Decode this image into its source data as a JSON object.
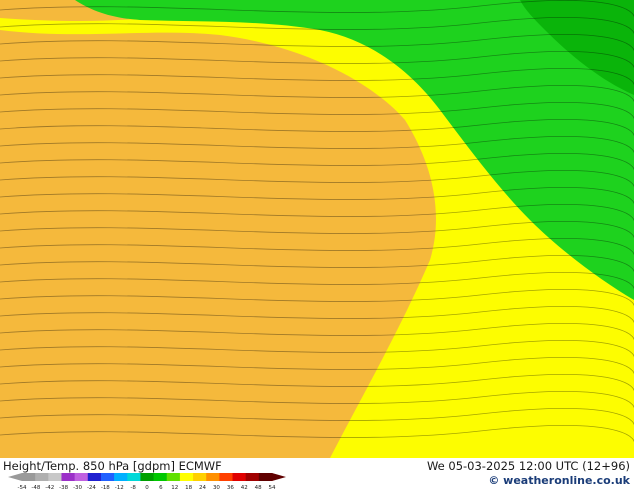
{
  "header": {
    "title": "Height/Temp. 850 hPa [gdpm] ECMWF",
    "valid_time": "We 05-03-2025 12:00 UTC (12+96)",
    "credit": "© weatheronline.co.uk"
  },
  "legend": {
    "ticks": [
      "-54",
      "-48",
      "-42",
      "-38",
      "-30",
      "-24",
      "-18",
      "-12",
      "-8",
      "0",
      "6",
      "12",
      "18",
      "24",
      "30",
      "36",
      "42",
      "48",
      "54"
    ],
    "colors": [
      "#9a9a9a",
      "#b0b0b0",
      "#c8c8c8",
      "#9b30c8",
      "#c060e0",
      "#2020d0",
      "#2060ff",
      "#00b0ff",
      "#00d8d8",
      "#00a000",
      "#00c800",
      "#60e000",
      "#ffff00",
      "#ffd000",
      "#ff9000",
      "#ff4000",
      "#e00000",
      "#a00000",
      "#600000"
    ]
  },
  "map": {
    "colors": {
      "orange": "#f5b93c",
      "yellow": "#fdfd00",
      "green_light": "#1ed21e",
      "green_dark": "#0ab40a",
      "contour": "#000000"
    }
  }
}
